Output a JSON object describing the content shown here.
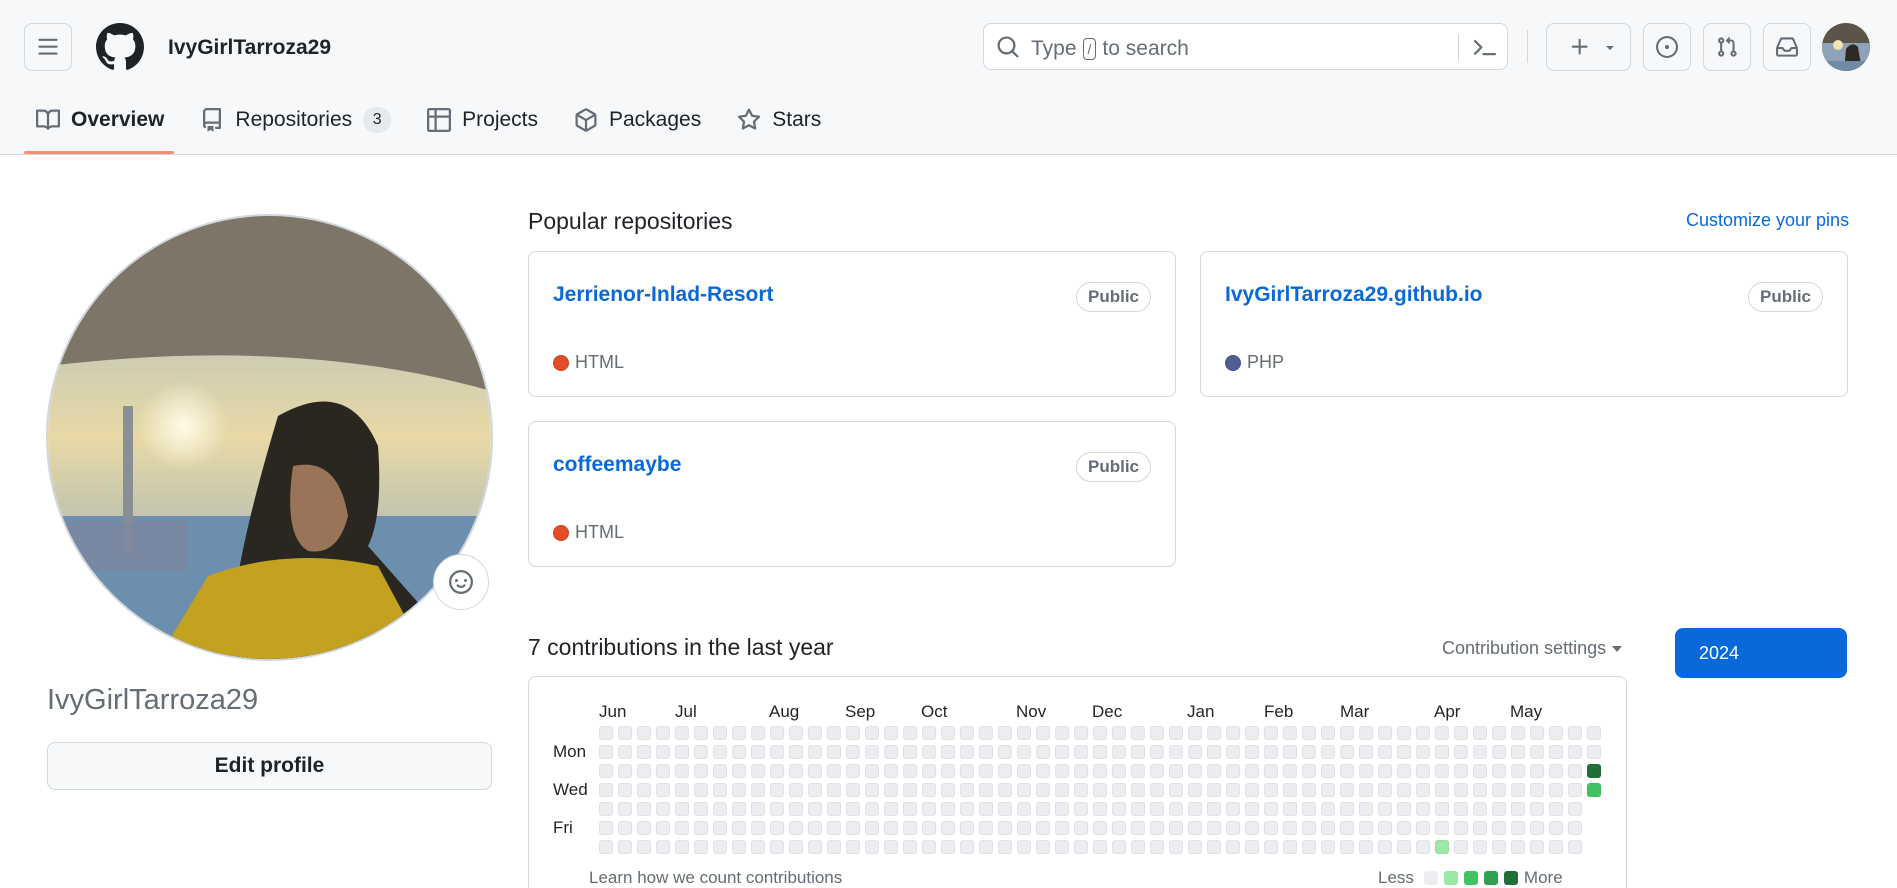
{
  "header": {
    "username": "IvyGirlTarroza29",
    "search": {
      "prefix": "Type",
      "key": "/",
      "suffix": "to search"
    }
  },
  "tabs": [
    {
      "label": "Overview",
      "active": true,
      "icon": "book-icon"
    },
    {
      "label": "Repositories",
      "count": "3",
      "icon": "repo-icon"
    },
    {
      "label": "Projects",
      "icon": "table-icon"
    },
    {
      "label": "Packages",
      "icon": "package-icon"
    },
    {
      "label": "Stars",
      "icon": "star-icon"
    }
  ],
  "profile": {
    "name": "IvyGirlTarroza29",
    "edit_label": "Edit profile"
  },
  "popular": {
    "title": "Popular repositories",
    "customize": "Customize your pins",
    "repos": [
      {
        "name": "Jerrienor-Inlad-Resort",
        "visibility": "Public",
        "language": "HTML",
        "lang_color": "#e34c26"
      },
      {
        "name": "IvyGirlTarroza29.github.io",
        "visibility": "Public",
        "language": "PHP",
        "lang_color": "#4F5D95"
      },
      {
        "name": "coffeemaybe",
        "visibility": "Public",
        "language": "HTML",
        "lang_color": "#e34c26"
      }
    ]
  },
  "contributions": {
    "title": "7 contributions in the last year",
    "settings_label": "Contribution settings",
    "year": "2024",
    "months": [
      "Jun",
      "Jul",
      "Aug",
      "Sep",
      "Oct",
      "Nov",
      "Dec",
      "Jan",
      "Feb",
      "Mar",
      "Apr",
      "May"
    ],
    "day_labels": [
      "Mon",
      "Wed",
      "Fri"
    ],
    "learn": "Learn how we count contributions",
    "less": "Less",
    "more": "More",
    "level_colors": [
      "#ebedf0",
      "#9be9a8",
      "#40c463",
      "#30a14e",
      "#216e39"
    ],
    "weeks": 53,
    "active_cells": [
      {
        "week": 52,
        "day": 2,
        "level": 4
      },
      {
        "week": 52,
        "day": 3,
        "level": 2
      },
      {
        "week": 44,
        "day": 6,
        "level": 1
      }
    ]
  }
}
